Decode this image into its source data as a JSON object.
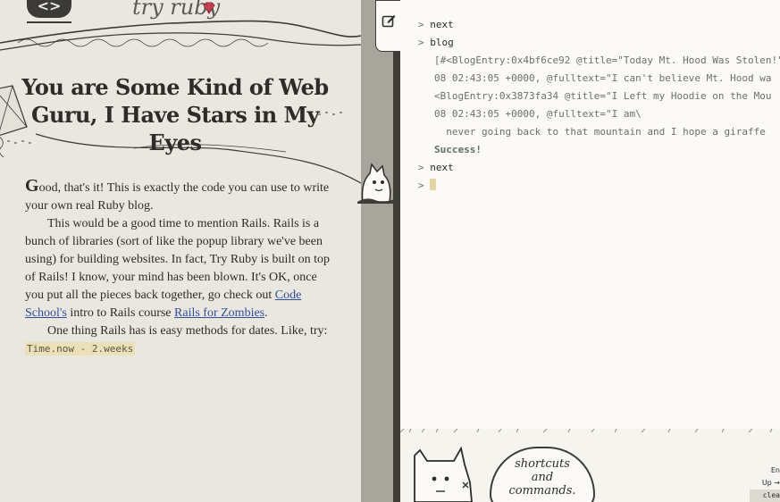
{
  "brand": {
    "name": "try ruby",
    "logo_glyph": "<>",
    "accent": "#d24b5a"
  },
  "lesson": {
    "title": "You are Some Kind of Web Guru, I Have Stars in My Eyes",
    "drop_cap": "G",
    "p1_rest": "ood, that's it! This is exactly the code you can use to write your own real Ruby blog.",
    "p2_before": "This would be a good time to mention Rails. Rails is a bunch of libraries (sort of like the popup library we've been using) for building websites. In fact, Try Ruby is built on top of Rails! I know, your mind has been blown. It's OK, once you put all the pieces back together, go check out ",
    "p2_link1": "Code School's",
    "p2_mid": " intro to Rails course ",
    "p2_link2": "Rails for Zombies",
    "p2_after": ".",
    "p3_before": "One thing Rails has is easy methods for dates. Like, try: ",
    "p3_code": "Time.now - 2.weeks"
  },
  "console": {
    "prompt_symbol": ">",
    "lines": [
      {
        "type": "input",
        "text": "next"
      },
      {
        "type": "input",
        "text": "blog"
      },
      {
        "type": "output",
        "text": "[#<BlogEntry:0x4bf6ce92 @title=\"Today Mt. Hood Was Stolen!\","
      },
      {
        "type": "output",
        "text": "08 02:43:05 +0000, @fulltext=\"I can't believe Mt. Hood wa"
      },
      {
        "type": "output",
        "text": "<BlogEntry:0x3873fa34 @title=\"I Left my Hoodie on the Mou"
      },
      {
        "type": "output",
        "text": "08 02:43:05 +0000, @fulltext=\"I am\\"
      },
      {
        "type": "output",
        "text": "  never going back to that mountain and I hope a giraffe"
      },
      {
        "type": "success",
        "text": "Success!"
      },
      {
        "type": "input",
        "text": "next"
      }
    ],
    "current_input": ""
  },
  "footer": {
    "bubble_lines": [
      "shortcuts",
      "and",
      "commands."
    ],
    "hints": [
      "En",
      "Up →",
      "clea"
    ]
  },
  "icons": {
    "edit": "edit-icon",
    "kite": "kite-icon",
    "mascot": "mascot-icon",
    "gem": "ruby-gem-icon"
  }
}
